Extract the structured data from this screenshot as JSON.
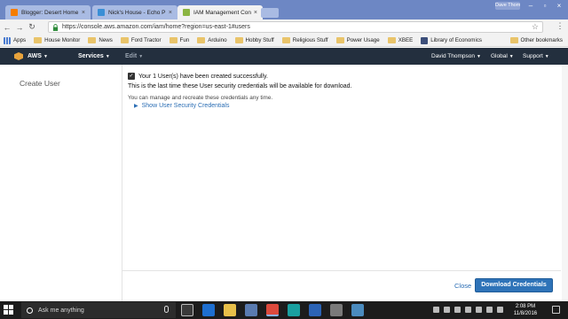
{
  "browser": {
    "tabs": [
      {
        "title": "Blogger: Desert Home - E",
        "favicon_color": "#f57d00"
      },
      {
        "title": "Nick's House - Echo PI W",
        "favicon_color": "#3a8fd6"
      },
      {
        "title": "IAM Management Conso",
        "favicon_color": "#8bb541"
      }
    ],
    "profile_label": "Dave Thompson",
    "url": "https://console.aws.amazon.com/iam/home?region=us-east-1#users",
    "bookmarks": [
      {
        "label": "Apps",
        "kind": "apps"
      },
      {
        "label": "House Monitor",
        "kind": "folder"
      },
      {
        "label": "News",
        "kind": "folder"
      },
      {
        "label": "Ford Tractor",
        "kind": "folder"
      },
      {
        "label": "Fun",
        "kind": "folder"
      },
      {
        "label": "Arduino",
        "kind": "folder"
      },
      {
        "label": "Hobby Stuff",
        "kind": "folder"
      },
      {
        "label": "Religious Stuff",
        "kind": "folder"
      },
      {
        "label": "Power Usage",
        "kind": "folder"
      },
      {
        "label": "XBEE",
        "kind": "folder"
      },
      {
        "label": "Library of Economics",
        "kind": "site"
      }
    ],
    "other_bookmarks": "Other bookmarks"
  },
  "aws": {
    "logo": "AWS",
    "services": "Services",
    "edit": "Edit",
    "user": "David Thompson",
    "region": "Global",
    "support": "Support"
  },
  "page": {
    "sidebar_title": "Create User",
    "success_message": "Your 1 User(s) have been created successfully.",
    "last_time_message": "This is the last time these User security credentials will be available for download.",
    "manage_message": "You can manage and recreate these credentials any time.",
    "show_credentials": "Show User Security Credentials",
    "close": "Close",
    "download": "Download Credentials"
  },
  "taskbar": {
    "search_placeholder": "Ask me anything",
    "time": "2:08 PM",
    "date": "11/8/2016"
  },
  "colors": {
    "aws_header": "#232f3e",
    "primary_button": "#2e73b8",
    "link": "#2a6db4",
    "tab_strip": "#6d87c4"
  }
}
